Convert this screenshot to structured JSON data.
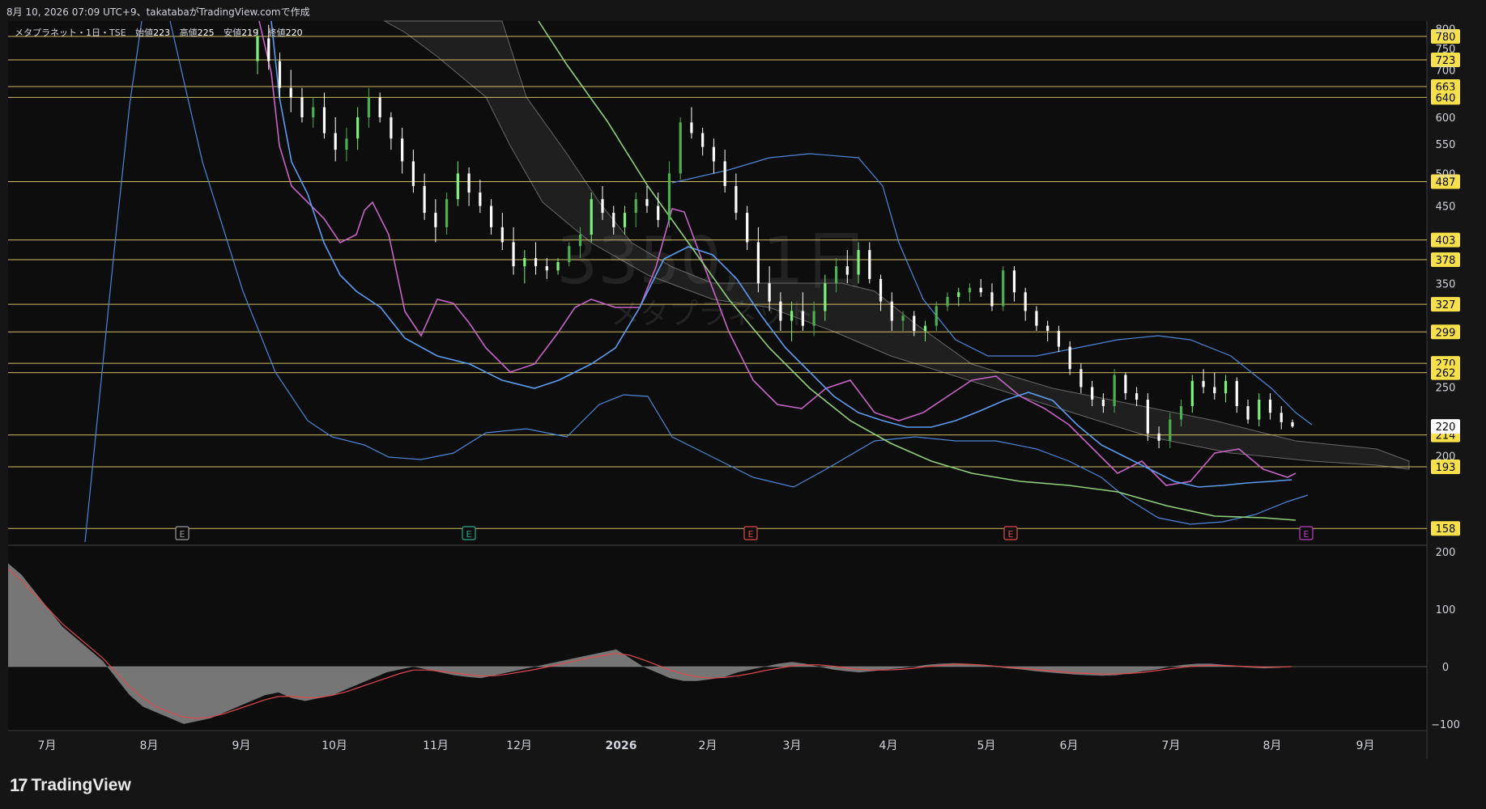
{
  "header": {
    "snapshot_text": "8月 10, 2026 07:09 UTC+9、takatabaがTradingView.comで作成"
  },
  "legend": {
    "name": "メタプラネット・1日・TSE",
    "open_label": "始値",
    "open_value": "223",
    "high_label": "高値",
    "high_value": "225",
    "low_label": "安値",
    "low_value": "219",
    "close_label": "終値",
    "close_value": "220"
  },
  "watermark": {
    "symbol": "3350, 1日",
    "name": "メタプラネット"
  },
  "footer": {
    "brand": "TradingView",
    "logo_icon": "tradingview-logo-icon"
  },
  "colors": {
    "background": "#0d0d0d",
    "up": "#4caf50",
    "up_bright": "#7cf27c",
    "down": "#ffffff",
    "level_line": "#e4d06b",
    "level_badge": "#f7e04a",
    "ma_short": "#c763c7",
    "ma_mid": "#5b9cf0",
    "ma_long": "#8fd17a",
    "bollinger": "#4c86d8",
    "cloud": "#777777",
    "osc_fill": "#8a8a8a",
    "osc_signal": "#e04a4a",
    "earnings_e": "#9a9a9a",
    "earnings_green": "#2aa88a",
    "earnings_red": "#e04a4a",
    "earnings_purple": "#c040c0"
  },
  "chart_data": {
    "type": "candlestick",
    "x_axis": {
      "labels": [
        "7月",
        "8月",
        "9月",
        "10月",
        "11月",
        "12月",
        "2026",
        "2月",
        "3月",
        "4月",
        "5月",
        "6月",
        "7月",
        "8月",
        "9月"
      ]
    },
    "y_axis": {
      "scale": "log",
      "ylim": [
        150,
        820
      ],
      "ticks": [
        800,
        750,
        700,
        600,
        550,
        500,
        450,
        350,
        250,
        200
      ]
    },
    "levels": [
      780,
      723,
      663,
      640,
      487,
      403,
      378,
      327,
      299,
      270,
      262,
      214,
      193,
      158
    ],
    "current_price": 220,
    "earnings_markers": [
      {
        "label": "E",
        "approx_date": "2025-08-14",
        "color": "earnings_e"
      },
      {
        "label": "E",
        "approx_date": "2025-11-13",
        "color": "earnings_green"
      },
      {
        "label": "E",
        "approx_date": "2026-02-16",
        "color": "earnings_red"
      },
      {
        "label": "E",
        "approx_date": "2026-05-14",
        "color": "earnings_red"
      },
      {
        "label": "E",
        "approx_date": "2026-08-13",
        "color": "earnings_purple"
      }
    ],
    "series": [
      {
        "values": [
          820,
          760,
          700,
          650,
          610,
          600,
          570,
          560,
          540,
          560,
          600,
          620,
          590,
          560,
          520,
          500,
          470,
          440,
          430,
          420,
          410,
          440,
          470,
          460,
          440,
          420,
          400,
          390,
          380,
          370,
          365,
          360,
          370,
          380,
          400,
          420,
          450,
          470,
          480,
          470,
          450,
          440,
          430,
          440,
          460,
          500,
          540,
          600,
          620,
          600,
          580,
          560,
          540,
          520,
          480,
          440,
          400,
          370,
          350,
          330,
          320,
          310,
          300,
          300,
          305,
          320,
          340,
          360,
          380,
          390,
          380,
          360,
          340,
          320,
          305,
          300,
          300,
          305,
          310,
          320,
          330,
          340,
          345,
          350,
          352,
          350,
          345,
          340,
          330,
          318,
          305,
          295,
          280,
          265,
          250,
          240,
          235,
          230,
          225,
          222,
          220,
          225,
          235,
          245,
          250,
          250,
          252,
          255,
          248,
          242,
          235,
          228,
          222,
          220
        ]
      },
      {
        "values": [
          660,
          640,
          600,
          560,
          530,
          510,
          490,
          470,
          460,
          440,
          430,
          420,
          410,
          405,
          400,
          398,
          395,
          400,
          405,
          410,
          420,
          430,
          440,
          450,
          450,
          440,
          430,
          420,
          410,
          400,
          395,
          390,
          385,
          380,
          375,
          372,
          370,
          368,
          365,
          362,
          360,
          358,
          356,
          354,
          352,
          350,
          348,
          346,
          344,
          342,
          340,
          338,
          335,
          332,
          330,
          328,
          326,
          324,
          322,
          320,
          318,
          315,
          312,
          308,
          304,
          300,
          295,
          290,
          285,
          280,
          275,
          270,
          265,
          260,
          255,
          250,
          245,
          240,
          235,
          230,
          225,
          220,
          215,
          210,
          208,
          205,
          203,
          200,
          198,
          197,
          196,
          195,
          194,
          193,
          192,
          191,
          190,
          189,
          188,
          187,
          186,
          185,
          184,
          183,
          182,
          181,
          180,
          179,
          178,
          177,
          176,
          175,
          174,
          173
        ]
      }
    ],
    "candles": [
      [
        720,
        800,
        690,
        780
      ],
      [
        775,
        810,
        700,
        720
      ],
      [
        720,
        740,
        640,
        660
      ],
      [
        660,
        700,
        610,
        640
      ],
      [
        640,
        660,
        590,
        600
      ],
      [
        600,
        640,
        580,
        620
      ],
      [
        620,
        650,
        560,
        570
      ],
      [
        570,
        600,
        520,
        540
      ],
      [
        540,
        580,
        520,
        560
      ],
      [
        560,
        620,
        540,
        600
      ],
      [
        600,
        660,
        580,
        640
      ],
      [
        640,
        650,
        590,
        600
      ],
      [
        600,
        610,
        540,
        560
      ],
      [
        560,
        580,
        500,
        520
      ],
      [
        520,
        540,
        470,
        480
      ],
      [
        480,
        500,
        430,
        440
      ],
      [
        440,
        460,
        400,
        420
      ],
      [
        420,
        470,
        410,
        460
      ],
      [
        460,
        520,
        450,
        500
      ],
      [
        500,
        510,
        450,
        470
      ],
      [
        470,
        490,
        440,
        450
      ],
      [
        450,
        460,
        410,
        420
      ],
      [
        420,
        440,
        390,
        400
      ],
      [
        400,
        420,
        360,
        370
      ],
      [
        370,
        390,
        350,
        380
      ],
      [
        380,
        400,
        360,
        370
      ],
      [
        370,
        380,
        355,
        365
      ],
      [
        365,
        380,
        360,
        375
      ],
      [
        375,
        400,
        370,
        395
      ],
      [
        395,
        420,
        380,
        410
      ],
      [
        410,
        470,
        400,
        460
      ],
      [
        460,
        480,
        430,
        440
      ],
      [
        440,
        450,
        410,
        420
      ],
      [
        420,
        450,
        410,
        440
      ],
      [
        440,
        470,
        420,
        460
      ],
      [
        460,
        480,
        440,
        450
      ],
      [
        450,
        470,
        420,
        430
      ],
      [
        430,
        520,
        420,
        500
      ],
      [
        500,
        600,
        490,
        590
      ],
      [
        590,
        620,
        560,
        570
      ],
      [
        570,
        580,
        530,
        545
      ],
      [
        545,
        560,
        500,
        520
      ],
      [
        520,
        540,
        470,
        480
      ],
      [
        480,
        500,
        430,
        440
      ],
      [
        440,
        450,
        390,
        400
      ],
      [
        400,
        420,
        340,
        350
      ],
      [
        350,
        370,
        320,
        330
      ],
      [
        330,
        340,
        300,
        310
      ],
      [
        310,
        330,
        290,
        320
      ],
      [
        320,
        340,
        300,
        305
      ],
      [
        305,
        330,
        295,
        320
      ],
      [
        320,
        360,
        310,
        350
      ],
      [
        350,
        380,
        340,
        370
      ],
      [
        370,
        390,
        350,
        360
      ],
      [
        360,
        400,
        350,
        390
      ],
      [
        390,
        400,
        350,
        355
      ],
      [
        355,
        360,
        320,
        330
      ],
      [
        330,
        340,
        300,
        310
      ],
      [
        310,
        320,
        300,
        315
      ],
      [
        315,
        320,
        295,
        300
      ],
      [
        300,
        310,
        290,
        305
      ],
      [
        305,
        330,
        300,
        325
      ],
      [
        325,
        340,
        320,
        335
      ],
      [
        335,
        345,
        325,
        340
      ],
      [
        340,
        350,
        330,
        345
      ],
      [
        345,
        355,
        335,
        340
      ],
      [
        340,
        350,
        320,
        325
      ],
      [
        325,
        370,
        320,
        365
      ],
      [
        365,
        370,
        330,
        340
      ],
      [
        340,
        345,
        310,
        320
      ],
      [
        320,
        325,
        300,
        305
      ],
      [
        305,
        310,
        290,
        300
      ],
      [
        300,
        305,
        280,
        285
      ],
      [
        285,
        290,
        260,
        265
      ],
      [
        265,
        270,
        245,
        250
      ],
      [
        250,
        255,
        235,
        240
      ],
      [
        240,
        245,
        230,
        235
      ],
      [
        235,
        265,
        230,
        260
      ],
      [
        260,
        262,
        240,
        245
      ],
      [
        245,
        250,
        235,
        240
      ],
      [
        240,
        245,
        210,
        215
      ],
      [
        215,
        220,
        205,
        210
      ],
      [
        210,
        230,
        205,
        225
      ],
      [
        225,
        240,
        220,
        235
      ],
      [
        235,
        260,
        230,
        255
      ],
      [
        255,
        265,
        245,
        250
      ],
      [
        250,
        262,
        240,
        245
      ],
      [
        245,
        260,
        238,
        255
      ],
      [
        255,
        258,
        230,
        235
      ],
      [
        235,
        240,
        222,
        225
      ],
      [
        225,
        245,
        220,
        240
      ],
      [
        240,
        245,
        225,
        230
      ],
      [
        230,
        235,
        218,
        223
      ],
      [
        223,
        225,
        219,
        220
      ]
    ]
  },
  "oscillator": {
    "y_ticks": [
      "200",
      "100",
      "0",
      "−100"
    ],
    "ylim": [
      -110,
      210
    ],
    "histogram": [
      180,
      160,
      130,
      100,
      70,
      50,
      30,
      10,
      -20,
      -50,
      -70,
      -80,
      -90,
      -100,
      -95,
      -90,
      -80,
      -70,
      -60,
      -50,
      -45,
      -55,
      -60,
      -55,
      -50,
      -40,
      -30,
      -20,
      -10,
      -5,
      0,
      -5,
      -10,
      -15,
      -18,
      -20,
      -15,
      -10,
      -5,
      0,
      5,
      10,
      15,
      20,
      25,
      30,
      15,
      0,
      -10,
      -20,
      -25,
      -25,
      -22,
      -18,
      -10,
      -5,
      0,
      5,
      8,
      5,
      0,
      -5,
      -8,
      -10,
      -8,
      -5,
      -3,
      0,
      3,
      5,
      6,
      5,
      3,
      0,
      -3,
      -5,
      -8,
      -10,
      -12,
      -14,
      -15,
      -16,
      -15,
      -12,
      -8,
      -5,
      0,
      3,
      5,
      5,
      3,
      0,
      -2,
      -3,
      -2,
      0
    ],
    "signal": [
      170,
      150,
      125,
      100,
      75,
      55,
      35,
      15,
      -10,
      -35,
      -55,
      -70,
      -80,
      -88,
      -90,
      -88,
      -82,
      -74,
      -66,
      -58,
      -52,
      -52,
      -54,
      -54,
      -50,
      -44,
      -36,
      -28,
      -20,
      -12,
      -6,
      -6,
      -8,
      -11,
      -14,
      -16,
      -16,
      -13,
      -9,
      -5,
      0,
      5,
      10,
      15,
      19,
      23,
      20,
      12,
      3,
      -6,
      -13,
      -18,
      -20,
      -19,
      -16,
      -12,
      -7,
      -3,
      1,
      3,
      3,
      1,
      -2,
      -5,
      -6,
      -6,
      -5,
      -3,
      0,
      2,
      4,
      4,
      3,
      1,
      -1,
      -3,
      -5,
      -7,
      -9,
      -11,
      -12,
      -13,
      -13,
      -12,
      -10,
      -7,
      -4,
      -1,
      1,
      2,
      2,
      1,
      0,
      -1,
      -1,
      0
    ],
    "signal_color": "osc_signal"
  }
}
